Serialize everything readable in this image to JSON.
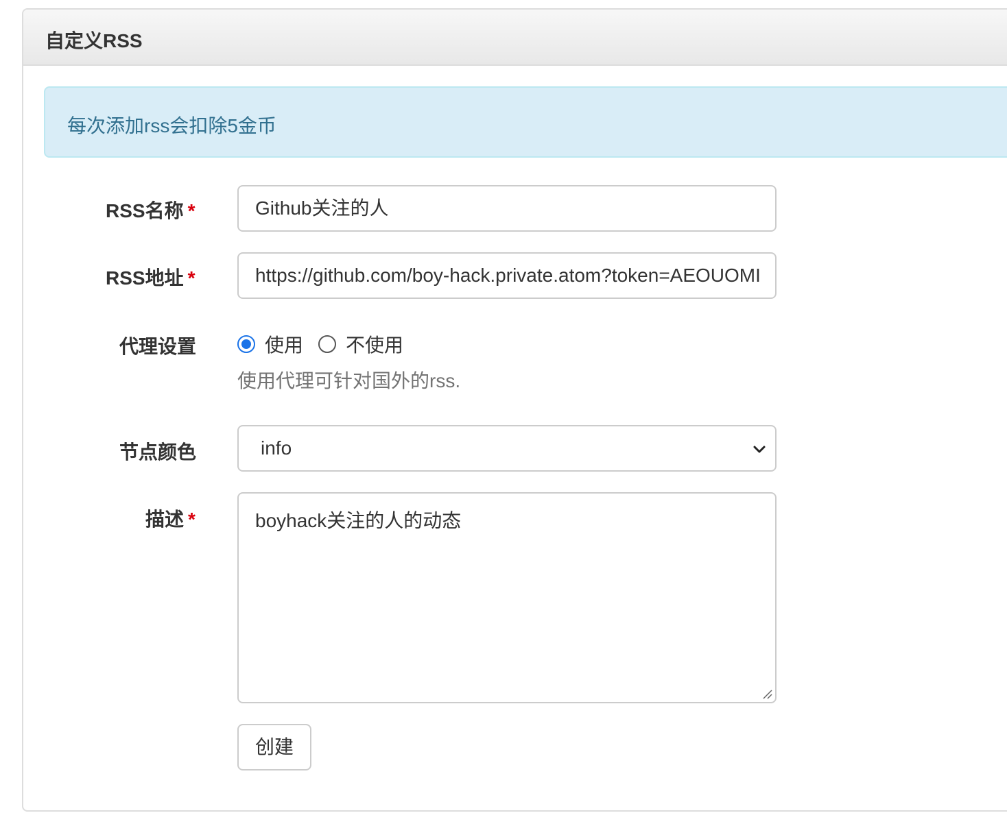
{
  "panel": {
    "title": "自定义RSS"
  },
  "alert": {
    "text": "每次添加rss会扣除5金币"
  },
  "form": {
    "rss_name": {
      "label": "RSS名称",
      "required_mark": "*",
      "value": "Github关注的人"
    },
    "rss_url": {
      "label": "RSS地址",
      "required_mark": "*",
      "value": "https://github.com/boy-hack.private.atom?token=AEOUOMI"
    },
    "proxy": {
      "label": "代理设置",
      "options": [
        {
          "label": "使用",
          "checked": true
        },
        {
          "label": "不使用",
          "checked": false
        }
      ],
      "help": "使用代理可针对国外的rss."
    },
    "node_color": {
      "label": "节点颜色",
      "selected": "info"
    },
    "description": {
      "label": "描述",
      "required_mark": "*",
      "value": "boyhack关注的人的动态"
    },
    "submit_label": "创建"
  },
  "colors": {
    "required": "#d9000d",
    "alert_bg": "#d9edf7",
    "alert_text": "#31708f",
    "radio_accent": "#1a73e8"
  }
}
